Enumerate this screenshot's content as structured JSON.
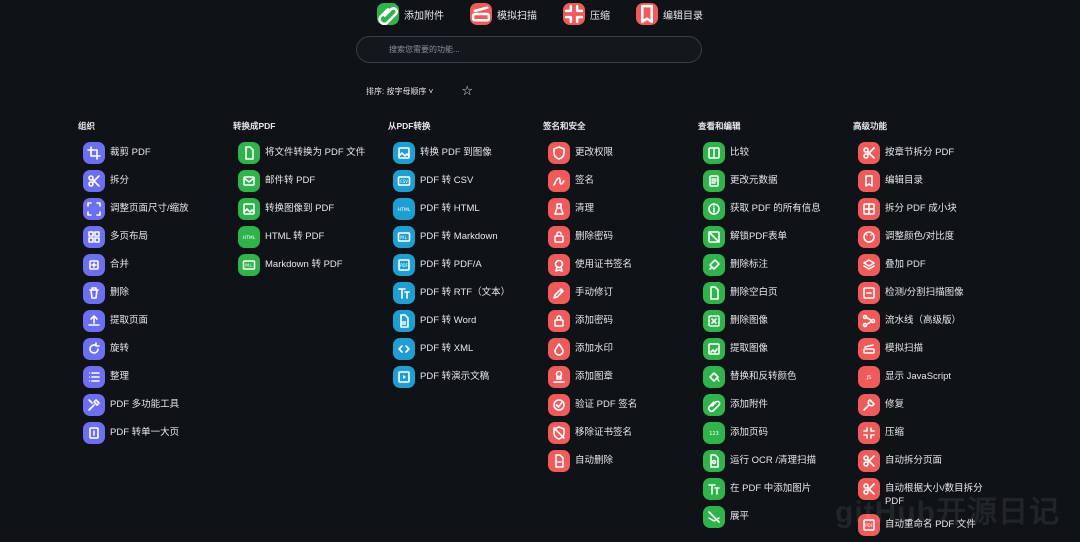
{
  "quick_access": [
    {
      "label": "添加附件",
      "icon": "paperclip-icon",
      "color": "#2fb34a"
    },
    {
      "label": "模拟扫描",
      "icon": "scanner-icon",
      "color": "#ef5b5b"
    },
    {
      "label": "压缩",
      "icon": "compress-icon",
      "color": "#ef5b5b"
    },
    {
      "label": "编辑目录",
      "icon": "bookmark-icon",
      "color": "#ef5b5b"
    }
  ],
  "search": {
    "placeholder": "搜索您需要的功能..."
  },
  "sort": {
    "label": "排序: 按字母顺序 ˅"
  },
  "watermark": "gitHub开源日记",
  "categories": [
    {
      "title": "组织",
      "color": "#6c6ff0",
      "tools": [
        {
          "label": "裁剪 PDF",
          "icon": "crop-icon"
        },
        {
          "label": "拆分",
          "icon": "scissors-icon"
        },
        {
          "label": "调整页面尺寸/缩放",
          "icon": "resize-icon"
        },
        {
          "label": "多页布局",
          "icon": "grid-icon"
        },
        {
          "label": "合并",
          "icon": "merge-icon"
        },
        {
          "label": "删除",
          "icon": "trash-icon"
        },
        {
          "label": "提取页面",
          "icon": "upload-icon"
        },
        {
          "label": "旋转",
          "icon": "rotate-icon"
        },
        {
          "label": "整理",
          "icon": "list-icon"
        },
        {
          "label": "PDF 多功能工具",
          "icon": "tools-icon"
        },
        {
          "label": "PDF 转单一大页",
          "icon": "single-page-icon"
        }
      ]
    },
    {
      "title": "转换成PDF",
      "color": "#2fb34a",
      "tools": [
        {
          "label": "将文件转换为 PDF 文件",
          "icon": "file-icon"
        },
        {
          "label": "邮件转 PDF",
          "icon": "mail-icon"
        },
        {
          "label": "转换图像到 PDF",
          "icon": "image-icon"
        },
        {
          "label": "HTML 转 PDF",
          "icon": "html-icon"
        },
        {
          "label": "Markdown 转 PDF",
          "icon": "markdown-icon"
        }
      ]
    },
    {
      "title": "从PDF转换",
      "color": "#1f9fd1",
      "tools": [
        {
          "label": "转换 PDF 到图像",
          "icon": "image-icon"
        },
        {
          "label": "PDF 转 CSV",
          "icon": "csv-icon"
        },
        {
          "label": "PDF 转 HTML",
          "icon": "html-icon"
        },
        {
          "label": "PDF 转 Markdown",
          "icon": "markdown-icon"
        },
        {
          "label": "PDF 转 PDF/A",
          "icon": "pdfa-icon"
        },
        {
          "label": "PDF 转 RTF（文本）",
          "icon": "text-icon"
        },
        {
          "label": "PDF 转 Word",
          "icon": "word-icon"
        },
        {
          "label": "PDF 转 XML",
          "icon": "code-icon"
        },
        {
          "label": "PDF 转演示文稿",
          "icon": "presentation-icon"
        }
      ]
    },
    {
      "title": "签名和安全",
      "color": "#ef5b5b",
      "tools": [
        {
          "label": "更改权限",
          "icon": "shield-icon"
        },
        {
          "label": "签名",
          "icon": "signature-icon"
        },
        {
          "label": "清理",
          "icon": "clean-icon"
        },
        {
          "label": "删除密码",
          "icon": "unlock-icon"
        },
        {
          "label": "使用证书签名",
          "icon": "certificate-icon"
        },
        {
          "label": "手动修订",
          "icon": "edit-icon"
        },
        {
          "label": "添加密码",
          "icon": "lock-icon"
        },
        {
          "label": "添加水印",
          "icon": "drop-icon"
        },
        {
          "label": "添加图章",
          "icon": "stamp-icon"
        },
        {
          "label": "验证 PDF 签名",
          "icon": "verify-icon"
        },
        {
          "label": "移除证书签名",
          "icon": "no-certificate-icon"
        },
        {
          "label": "自动删除",
          "icon": "auto-delete-icon"
        }
      ]
    },
    {
      "title": "查看和编辑",
      "color": "#2fb34a",
      "tools": [
        {
          "label": "比较",
          "icon": "compare-icon"
        },
        {
          "label": "更改元数据",
          "icon": "metadata-icon"
        },
        {
          "label": "获取 PDF 的所有信息",
          "icon": "info-icon"
        },
        {
          "label": "解锁PDF表单",
          "icon": "form-icon"
        },
        {
          "label": "删除标注",
          "icon": "annotation-icon"
        },
        {
          "label": "删除空白页",
          "icon": "blank-page-icon"
        },
        {
          "label": "删除图像",
          "icon": "remove-image-icon"
        },
        {
          "label": "提取图像",
          "icon": "extract-image-icon"
        },
        {
          "label": "替换和反转颜色",
          "icon": "paint-bucket-icon"
        },
        {
          "label": "添加附件",
          "icon": "paperclip-icon"
        },
        {
          "label": "添加页码",
          "icon": "page-number-icon"
        },
        {
          "label": "运行 OCR /清理扫描",
          "icon": "ocr-icon"
        },
        {
          "label": "在 PDF 中添加图片",
          "icon": "text-icon"
        },
        {
          "label": "展平",
          "icon": "flatten-icon"
        }
      ]
    },
    {
      "title": "高级功能",
      "color": "#ef5b5b",
      "tools": [
        {
          "label": "按章节拆分 PDF",
          "icon": "scissors-icon"
        },
        {
          "label": "编辑目录",
          "icon": "bookmark-icon"
        },
        {
          "label": "拆分 PDF 成小块",
          "icon": "split-blocks-icon"
        },
        {
          "label": "调整颜色/对比度",
          "icon": "palette-icon"
        },
        {
          "label": "叠加 PDF",
          "icon": "layers-icon"
        },
        {
          "label": "检测/分割扫描图像",
          "icon": "detect-icon"
        },
        {
          "label": "流水线（高级版）",
          "icon": "pipeline-icon"
        },
        {
          "label": "模拟扫描",
          "icon": "scanner-icon"
        },
        {
          "label": "显示 JavaScript",
          "icon": "javascript-icon"
        },
        {
          "label": "修复",
          "icon": "repair-icon"
        },
        {
          "label": "压缩",
          "icon": "compress-icon"
        },
        {
          "label": "自动拆分页面",
          "icon": "scissors-icon"
        },
        {
          "label": "自动根据大小/数目拆分 PDF",
          "icon": "scissors-icon"
        },
        {
          "label": "自动重命名 PDF 文件",
          "icon": "rename-icon"
        }
      ]
    }
  ]
}
